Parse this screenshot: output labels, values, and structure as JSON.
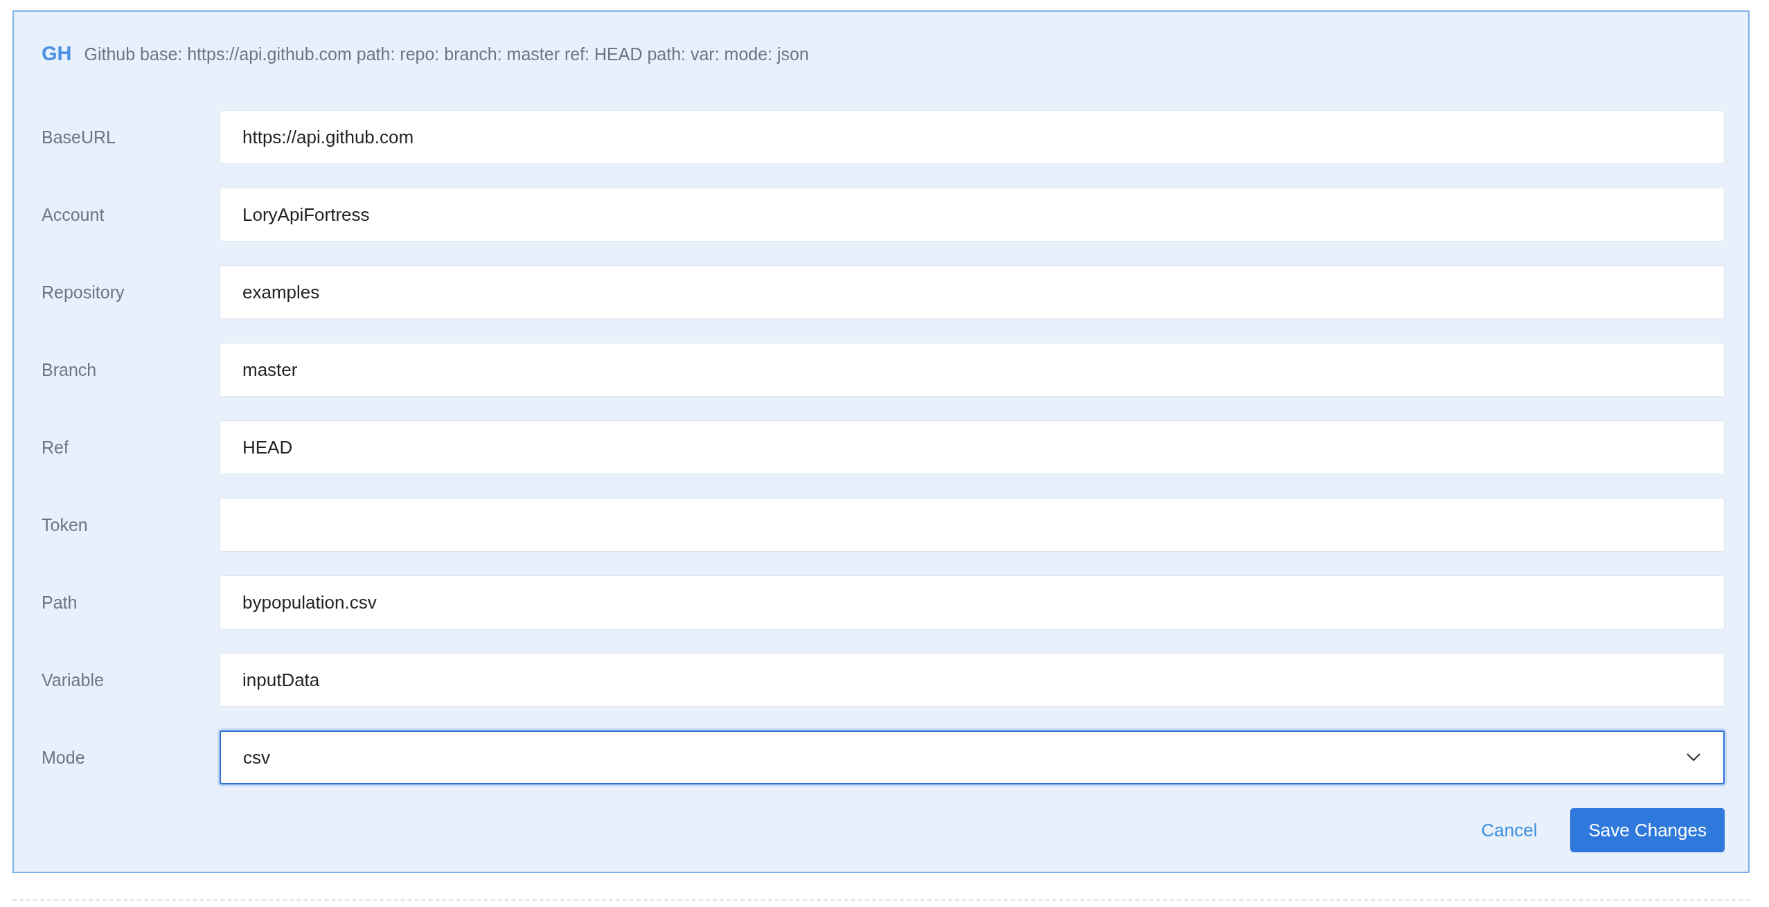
{
  "header": {
    "badge": "GH",
    "summary": "Github base: https://api.github.com path: repo: branch: master ref: HEAD path: var: mode: json"
  },
  "fields": [
    {
      "label": "BaseURL",
      "kind": "text",
      "value": "https://api.github.com",
      "focused": false
    },
    {
      "label": "Account",
      "kind": "text",
      "value": "LoryApiFortress",
      "focused": false
    },
    {
      "label": "Repository",
      "kind": "text",
      "value": "examples",
      "focused": false
    },
    {
      "label": "Branch",
      "kind": "text",
      "value": "master",
      "focused": false
    },
    {
      "label": "Ref",
      "kind": "text",
      "value": "HEAD",
      "focused": false
    },
    {
      "label": "Token",
      "kind": "text",
      "focused": false
    },
    {
      "label": "Path",
      "kind": "text",
      "value": "bypopulation.csv",
      "focused": false
    },
    {
      "label": "Variable",
      "kind": "text",
      "value": "inputData",
      "focused": false
    },
    {
      "label": "Mode",
      "kind": "select",
      "value": "csv",
      "focused": true
    }
  ],
  "buttons": [
    {
      "label": "Cancel",
      "kind": "link"
    },
    {
      "label": "Save Changes",
      "kind": "primary"
    }
  ]
}
